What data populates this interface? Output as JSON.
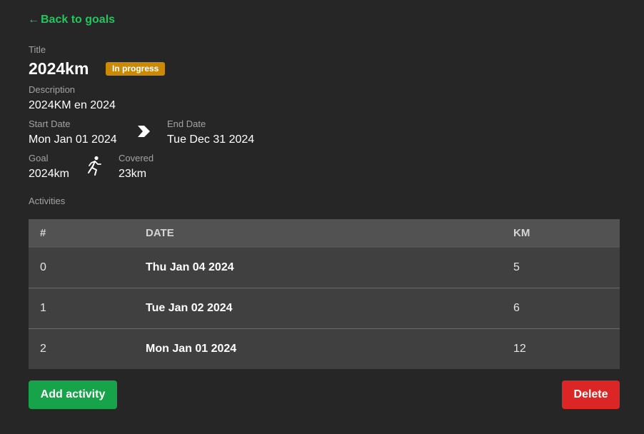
{
  "nav": {
    "back_arrow": "←",
    "back_label": "Back to goals"
  },
  "goal": {
    "title_label": "Title",
    "title": "2024km",
    "status": "In progress",
    "description_label": "Description",
    "description": "2024KM en 2024",
    "start_label": "Start Date",
    "start_date": "Mon Jan 01 2024",
    "end_label": "End Date",
    "end_date": "Tue Dec 31 2024",
    "goal_label": "Goal",
    "goal_value": "2024km",
    "covered_label": "Covered",
    "covered_value": "23km",
    "activities_label": "Activities"
  },
  "icons": {
    "date_range": "chevron-right-icon",
    "runner": "running-person-icon"
  },
  "table": {
    "headers": [
      "#",
      "DATE",
      "KM"
    ],
    "rows": [
      [
        "0",
        "Thu Jan 04 2024",
        "5"
      ],
      [
        "1",
        "Tue Jan 02 2024",
        "6"
      ],
      [
        "2",
        "Mon Jan 01 2024",
        "12"
      ]
    ]
  },
  "actions": {
    "add_label": "Add activity",
    "delete_label": "Delete"
  },
  "colors": {
    "background": "#262626",
    "accent_green": "#22c55e",
    "badge": "#ca8a04",
    "add_button": "#16a34a",
    "delete_button": "#dc2626"
  }
}
